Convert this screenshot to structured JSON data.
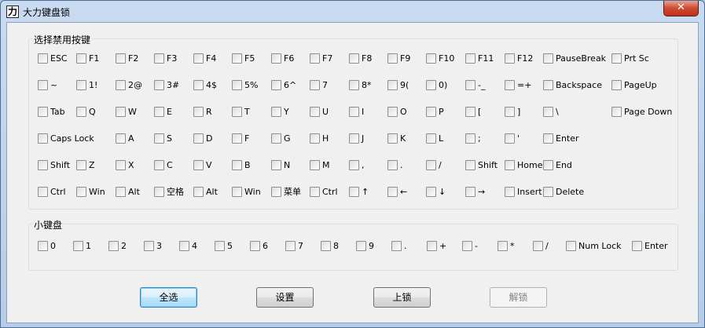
{
  "window": {
    "title": "大力键盘锁",
    "app_icon_glyph": "力",
    "close_glyph": "✕"
  },
  "groups": {
    "main_keys": {
      "title": "选择禁用按键",
      "rows": [
        [
          "ESC",
          "F1",
          "F2",
          "F3",
          "F4",
          "F5",
          "F6",
          "F7",
          "F8",
          "F9",
          "F10",
          "F11",
          "F12",
          "PauseBreak",
          "Prt Sc"
        ],
        [
          "~",
          "1!",
          "2@",
          "3#",
          "4$",
          "5%",
          "6^",
          "7",
          "8*",
          "9(",
          "0)",
          "-_",
          "=+",
          "Backspace",
          "PageUp"
        ],
        [
          "Tab",
          "Q",
          "W",
          "E",
          "R",
          "T",
          "Y",
          "U",
          "I",
          "O",
          "P",
          "[",
          "]",
          "\\",
          "Page Down"
        ],
        [
          "Caps Lock",
          "A",
          "S",
          "D",
          "F",
          "G",
          "H",
          "J",
          "K",
          "L",
          ";",
          "'",
          "Enter"
        ],
        [
          "Shift",
          "Z",
          "X",
          "C",
          "V",
          "B",
          "N",
          "M",
          ",",
          ".",
          "/",
          "Shift",
          "Home",
          "End"
        ],
        [
          "Ctrl",
          "Win",
          "Alt",
          "空格",
          "Alt",
          "Win",
          "菜单",
          "Ctrl",
          "↑",
          "←",
          "↓",
          "→",
          "Insert",
          "Delete"
        ]
      ]
    },
    "numpad": {
      "title": "小键盘",
      "keys": [
        "0",
        "1",
        "2",
        "3",
        "4",
        "5",
        "6",
        "7",
        "8",
        "9",
        ".",
        "+",
        "-",
        "*",
        "/",
        "Num Lock",
        "Enter"
      ]
    }
  },
  "buttons": {
    "select_all": "全选",
    "settings": "设置",
    "lock": "上锁",
    "unlock": "解锁"
  }
}
